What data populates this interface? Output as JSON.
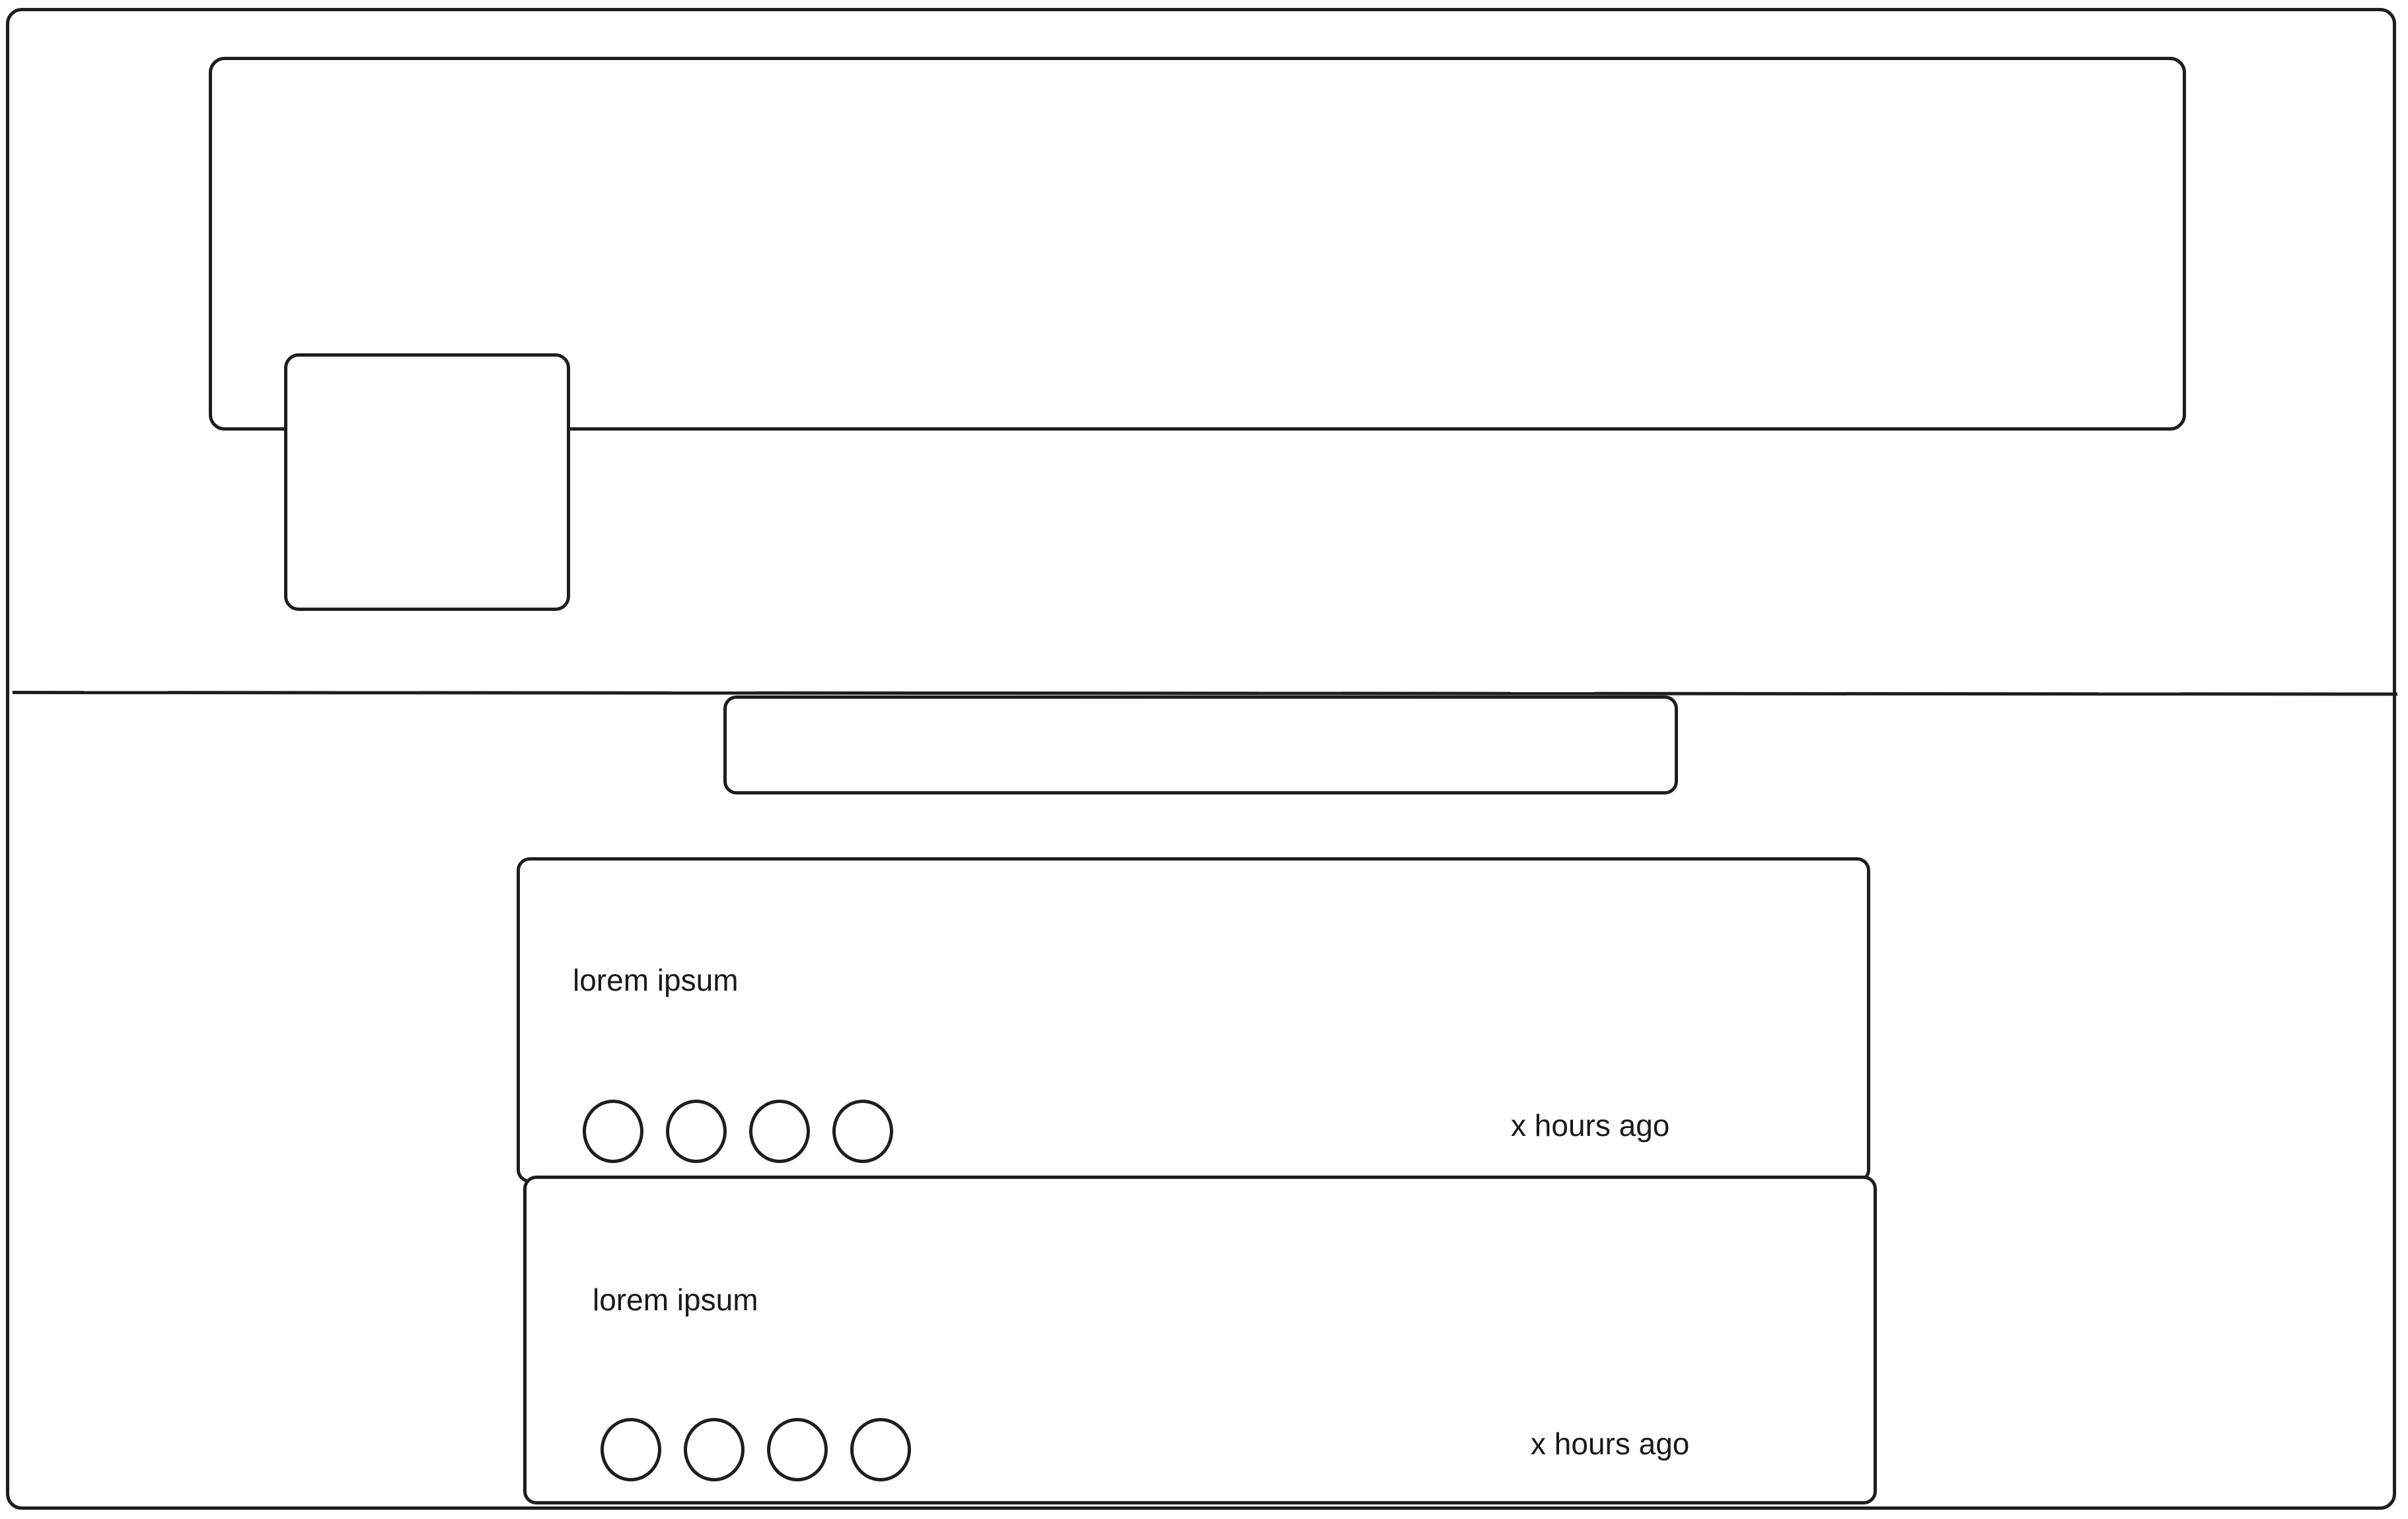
{
  "profile": {
    "cover_icon": "image-placeholder",
    "avatar_icon": "image-placeholder"
  },
  "search": {
    "value": ""
  },
  "posts": [
    {
      "text": "lorem ipsum",
      "time": "x hours ago",
      "reactions": [
        "reaction-circle",
        "reaction-circle",
        "reaction-circle",
        "reaction-circle"
      ]
    },
    {
      "text": "lorem ipsum",
      "time": "x hours ago",
      "reactions": [
        "reaction-circle",
        "reaction-circle",
        "reaction-circle",
        "reaction-circle"
      ]
    }
  ]
}
